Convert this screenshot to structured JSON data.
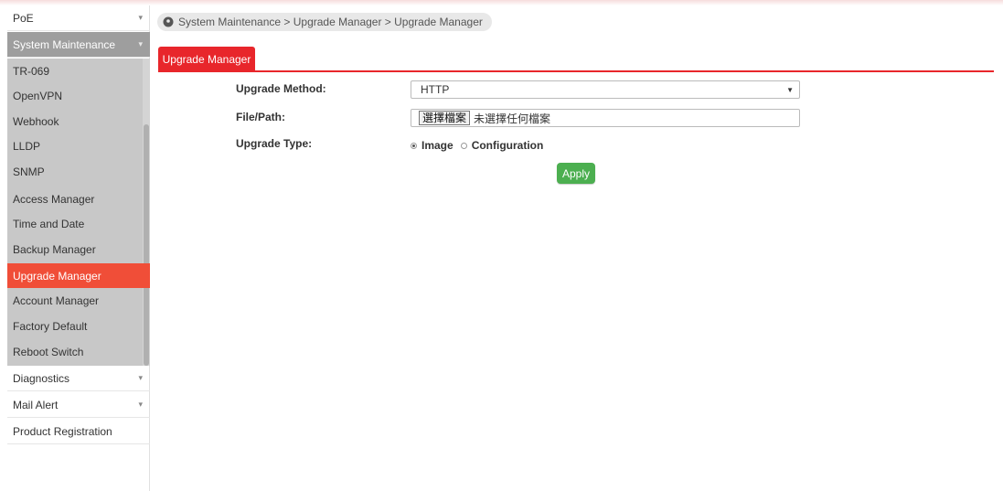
{
  "sidebar": {
    "poe": {
      "label": "PoE"
    },
    "system_maintenance": {
      "label": "System Maintenance",
      "items": [
        {
          "label": "TR-069"
        },
        {
          "label": "OpenVPN"
        },
        {
          "label": "Webhook"
        },
        {
          "label": "LLDP"
        },
        {
          "label": "SNMP"
        },
        {
          "label": "Access Manager"
        },
        {
          "label": "Time and Date"
        },
        {
          "label": "Backup Manager"
        },
        {
          "label": "Upgrade Manager",
          "active": true
        },
        {
          "label": "Account Manager"
        },
        {
          "label": "Factory Default"
        },
        {
          "label": "Reboot Switch"
        }
      ]
    },
    "diagnostics": {
      "label": "Diagnostics"
    },
    "mail_alert": {
      "label": "Mail Alert"
    },
    "product_registration": {
      "label": "Product Registration"
    }
  },
  "breadcrumb": {
    "text": "System Maintenance > Upgrade Manager > Upgrade Manager"
  },
  "tab": {
    "label": "Upgrade Manager"
  },
  "form": {
    "upgrade_method_label": "Upgrade Method:",
    "upgrade_method_value": "HTTP",
    "file_path_label": "File/Path:",
    "file_button_label": "選擇檔案",
    "file_status": "未選擇任何檔案",
    "upgrade_type_label": "Upgrade Type:",
    "upgrade_type_options": [
      {
        "label": "Image",
        "checked": true
      },
      {
        "label": "Configuration",
        "checked": false
      }
    ],
    "apply_label": "Apply"
  },
  "colors": {
    "accent_red": "#e8262b",
    "active_item": "#f04e38",
    "apply_green": "#4caf50",
    "group_header": "#9e9e9e"
  }
}
